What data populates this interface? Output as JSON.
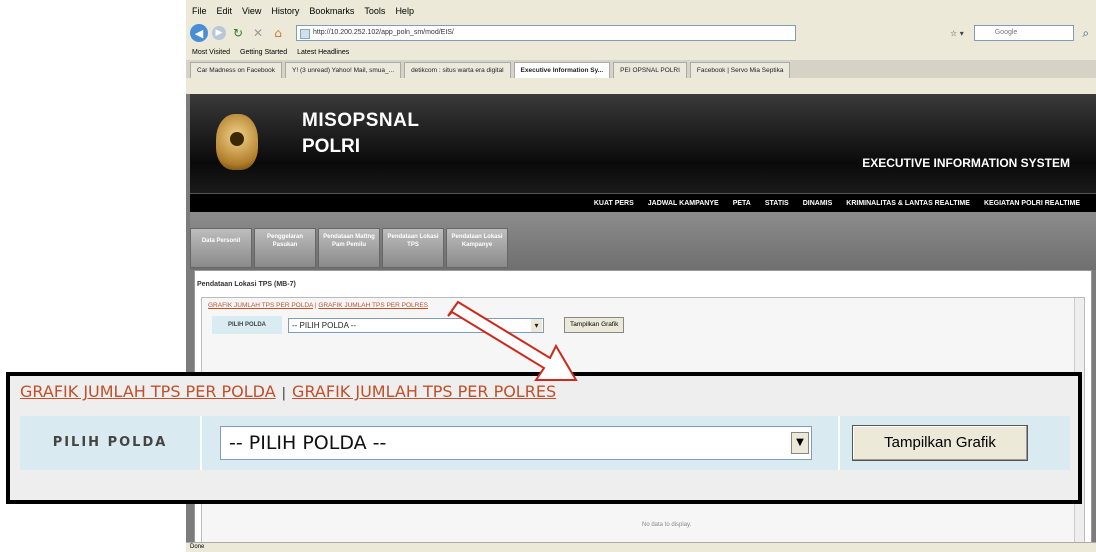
{
  "browser": {
    "menu": [
      "File",
      "Edit",
      "View",
      "History",
      "Bookmarks",
      "Tools",
      "Help"
    ],
    "url": "http://10.200.252.102/app_poln_sm/mod/EIS/",
    "search_placeholder": "Google",
    "bookmarks": [
      "Most Visited",
      "Getting Started",
      "Latest Headlines"
    ],
    "tabs": [
      {
        "label": "Car Madness on Facebook"
      },
      {
        "label": "Y! (3 unread) Yahoo! Mail, smua_..."
      },
      {
        "label": "detikcom : situs warta era digital"
      },
      {
        "label": "Executive Information Sy..."
      },
      {
        "label": "PEI OPSNAL POLRI"
      },
      {
        "label": "Facebook | Servo Mia Septika"
      }
    ],
    "status": "Done"
  },
  "site": {
    "brand_line1": "MISOPSNAL",
    "brand_line2": "POLRI",
    "subtitle": "EXECUTIVE INFORMATION SYSTEM",
    "nav": [
      "KUAT PERS",
      "JADWAL KAMPANYE",
      "PETA",
      "STATIS",
      "DINAMIS",
      "KRIMINALITAS & LANTAS REALTIME",
      "KEGIATAN POLRI REALTIME"
    ],
    "tabs": [
      {
        "label": "Data Personil"
      },
      {
        "label": "Penggelaran Pasukan"
      },
      {
        "label": "Pendataan Mattng Pam Pemilu"
      },
      {
        "label": "Pendataan Lokasi TPS"
      },
      {
        "label": "Pendataan Lokasi Kampanye"
      }
    ],
    "panel_title": "Pendataan Lokasi TPS (MB-7)",
    "no_data": "No data to display."
  },
  "form": {
    "link_polda": "GRAFIK JUMLAH TPS PER POLDA",
    "separator": "|",
    "link_polres": "GRAFIK JUMLAH TPS PER POLRES",
    "label": "PILIH POLDA",
    "select_value": "-- PILIH POLDA --",
    "button": "Tampilkan Grafik"
  }
}
